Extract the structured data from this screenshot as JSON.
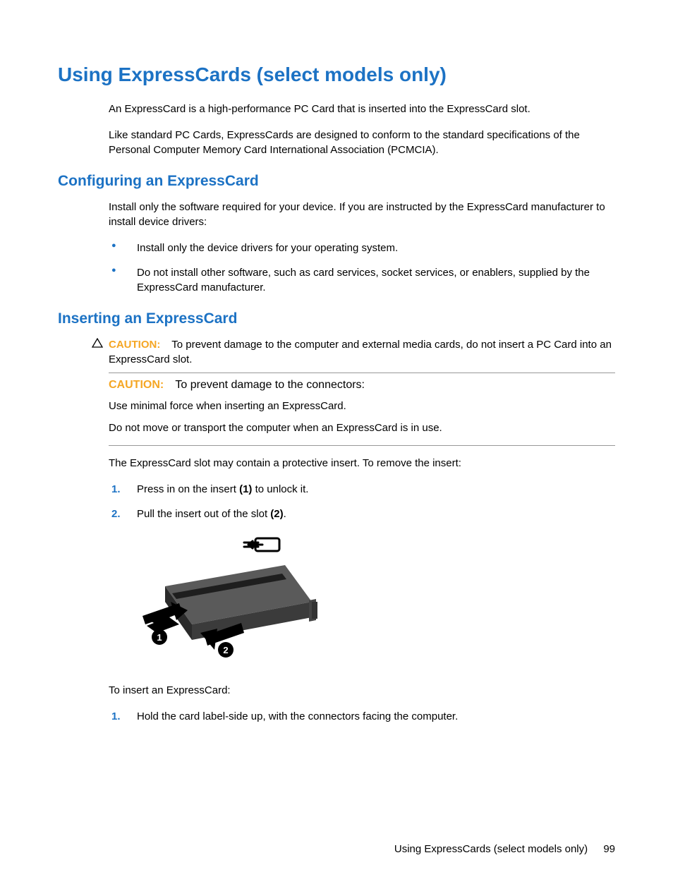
{
  "h1": "Using ExpressCards (select models only)",
  "intro1": "An ExpressCard is a high-performance PC Card that is inserted into the ExpressCard slot.",
  "intro2": "Like standard PC Cards, ExpressCards are designed to conform to the standard specifications of the Personal Computer Memory Card International Association (PCMCIA).",
  "h2a": "Configuring an ExpressCard",
  "configIntro": "Install only the software required for your device. If you are instructed by the ExpressCard manufacturer to install device drivers:",
  "bullet1": "Install only the device drivers for your operating system.",
  "bullet2": "Do not install other software, such as card services, socket services, or enablers, supplied by the ExpressCard manufacturer.",
  "h2b": "Inserting an ExpressCard",
  "cautionLabel": "CAUTION:",
  "caution1": "To prevent damage to the computer and external media cards, do not insert a PC Card into an ExpressCard slot.",
  "caution2": "To prevent damage to the connectors:",
  "caution2a": "Use minimal force when inserting an ExpressCard.",
  "caution2b": "Do not move or transport the computer when an ExpressCard is in use.",
  "removeIntro": "The ExpressCard slot may contain a protective insert. To remove the insert:",
  "step1a": "Press in on the insert ",
  "step1b": "(1)",
  "step1c": " to unlock it.",
  "step2a": "Pull the insert out of the slot ",
  "step2b": "(2)",
  "step2c": ".",
  "num1": "1.",
  "num2": "2.",
  "insertIntro": "To insert an ExpressCard:",
  "insertStep1": "Hold the card label-side up, with the connectors facing the computer.",
  "footerText": "Using ExpressCards (select models only)",
  "pageNum": "99"
}
